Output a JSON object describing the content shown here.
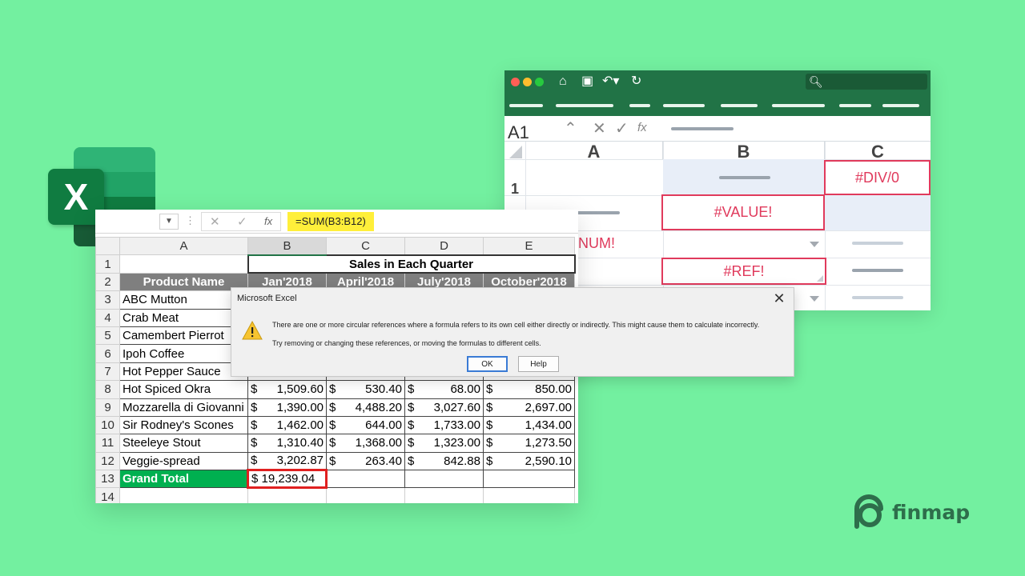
{
  "back_window": {
    "name_box": "A1",
    "fx_label": "fx",
    "columns": [
      "A",
      "B",
      "C"
    ],
    "row_number": "1",
    "errors": {
      "div0": "#DIV/0",
      "value": "#VALUE!",
      "num": "NUM!",
      "ref": "#REF!"
    }
  },
  "front_window": {
    "fx_label": "fx",
    "formula": "=SUM(B3:B12)",
    "column_headers": [
      "A",
      "B",
      "C",
      "D",
      "E"
    ],
    "title": "Sales in Each Quarter",
    "header_row": [
      "Product Name",
      "Jan'2018",
      "April'2018",
      "July'2018",
      "October'2018"
    ],
    "rows": [
      {
        "name": "ABC Mutton",
        "values": [
          "",
          "",
          "",
          ""
        ]
      },
      {
        "name": "Crab Meat",
        "values": [
          "",
          "",
          "",
          ""
        ]
      },
      {
        "name": "Camembert Pierrot",
        "values": [
          "",
          "",
          "",
          ""
        ]
      },
      {
        "name": "Ipoh Coffee",
        "values": [
          "",
          "",
          "",
          ""
        ]
      },
      {
        "name": "Hot Pepper Sauce",
        "values": [
          "",
          "",
          "",
          ""
        ]
      },
      {
        "name": " Hot Spiced Okra",
        "values": [
          "1,509.60",
          "530.40",
          "68.00",
          "850.00"
        ]
      },
      {
        "name": "Mozzarella di Giovanni",
        "values": [
          "1,390.00",
          "4,488.20",
          "3,027.60",
          "2,697.00"
        ]
      },
      {
        "name": "Sir Rodney's Scones",
        "values": [
          "1,462.00",
          "644.00",
          "1,733.00",
          "1,434.00"
        ]
      },
      {
        "name": "Steeleye Stout",
        "values": [
          "1,310.40",
          "1,368.00",
          "1,323.00",
          "1,273.50"
        ]
      },
      {
        "name": "Veggie-spread",
        "values": [
          "3,202.87",
          "263.40",
          "842.88",
          "2,590.10"
        ]
      }
    ],
    "currency_symbol": "$",
    "grand_total_label": "Grand Total",
    "grand_total_value": "$ 19,239.04",
    "row_numbers": [
      "1",
      "2",
      "3",
      "4",
      "5",
      "6",
      "7",
      "8",
      "9",
      "10",
      "11",
      "12",
      "13",
      "14"
    ]
  },
  "dialog": {
    "title": "Microsoft Excel",
    "message_line1": "There are one or more circular references where a formula refers to its own cell either directly or indirectly. This might cause them to calculate incorrectly.",
    "message_line2": "Try removing or changing these references, or moving the formulas to different cells.",
    "ok_label": "OK",
    "help_label": "Help"
  },
  "brand": {
    "logo_letter": "X",
    "finmap_label": "finmap"
  },
  "colors": {
    "background": "#73f0a0",
    "excel_green": "#217346",
    "error_red": "#e03a5c",
    "formula_highlight": "#ffef3a",
    "grand_total_green": "#00b050",
    "header_gray": "#7f7f7f"
  }
}
